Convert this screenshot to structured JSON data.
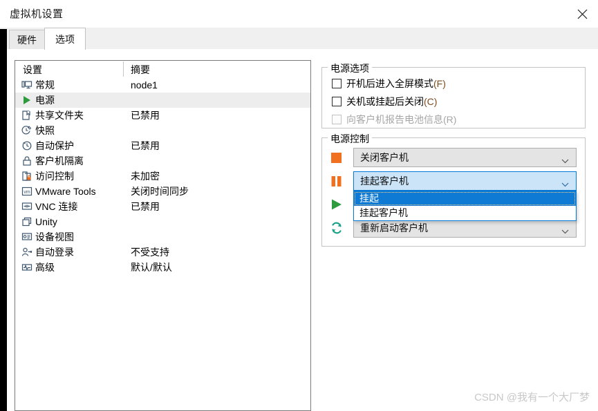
{
  "window": {
    "title": "虚拟机设置",
    "close_icon": "close-icon"
  },
  "tabs": [
    {
      "label": "硬件",
      "active": false
    },
    {
      "label": "选项",
      "active": true
    }
  ],
  "settings_list": {
    "headers": {
      "setting": "设置",
      "summary": "摘要"
    },
    "rows": [
      {
        "icon": "monitor-icon",
        "label": "常规",
        "summary": "node1",
        "selected": false
      },
      {
        "icon": "play-icon",
        "label": "电源",
        "summary": "",
        "selected": true
      },
      {
        "icon": "folder-icon",
        "label": "共享文件夹",
        "summary": "已禁用",
        "selected": false
      },
      {
        "icon": "snapshot-clock-icon",
        "label": "快照",
        "summary": "",
        "selected": false
      },
      {
        "icon": "clock-back-icon",
        "label": "自动保护",
        "summary": "已禁用",
        "selected": false
      },
      {
        "icon": "lock-icon",
        "label": "客户机隔离",
        "summary": "",
        "selected": false
      },
      {
        "icon": "access-lock-icon",
        "label": "访问控制",
        "summary": "未加密",
        "selected": false
      },
      {
        "icon": "vmware-tools-icon",
        "label": "VMware Tools",
        "summary": "关闭时间同步",
        "selected": false
      },
      {
        "icon": "vnc-icon",
        "label": "VNC 连接",
        "summary": "已禁用",
        "selected": false
      },
      {
        "icon": "unity-icon",
        "label": "Unity",
        "summary": "",
        "selected": false
      },
      {
        "icon": "device-view-icon",
        "label": "设备视图",
        "summary": "",
        "selected": false
      },
      {
        "icon": "auto-login-icon",
        "label": "自动登录",
        "summary": "不受支持",
        "selected": false
      },
      {
        "icon": "advanced-icon",
        "label": "高级",
        "summary": "默认/默认",
        "selected": false
      }
    ]
  },
  "power_options": {
    "group_label": "电源选项",
    "checkboxes": [
      {
        "label": "开机后进入全屏模式",
        "accesskey": "(F)",
        "checked": false,
        "disabled": false
      },
      {
        "label": "关机或挂起后关闭",
        "accesskey": "(C)",
        "checked": false,
        "disabled": false
      },
      {
        "label": "向客户机报告电池信息",
        "accesskey": "(R)",
        "checked": false,
        "disabled": true
      }
    ]
  },
  "power_control": {
    "group_label": "电源控制",
    "rows": [
      {
        "icon": "stop-square-icon",
        "value": "关闭客户机",
        "open": false
      },
      {
        "icon": "pause-bars-icon",
        "value": "挂起客户机",
        "open": true
      },
      {
        "icon": "play-triangle-icon",
        "value": "",
        "open": false
      },
      {
        "icon": "restart-arrows-icon",
        "value": "重新启动客户机",
        "open": false
      }
    ],
    "dropdown": {
      "options": [
        {
          "label": "挂起",
          "highlighted": true
        },
        {
          "label": "挂起客户机",
          "highlighted": false
        }
      ]
    }
  },
  "watermark": {
    "text": "CSDN @我有一个大厂梦"
  },
  "colors": {
    "accent_blue": "#0078d7",
    "highlight_blue": "#0f7ad4",
    "combo_open_bg": "#cbe4f7",
    "orange": "#f07020",
    "green": "#2e9b3e",
    "teal": "#16a085",
    "row_selected": "#ededed"
  }
}
